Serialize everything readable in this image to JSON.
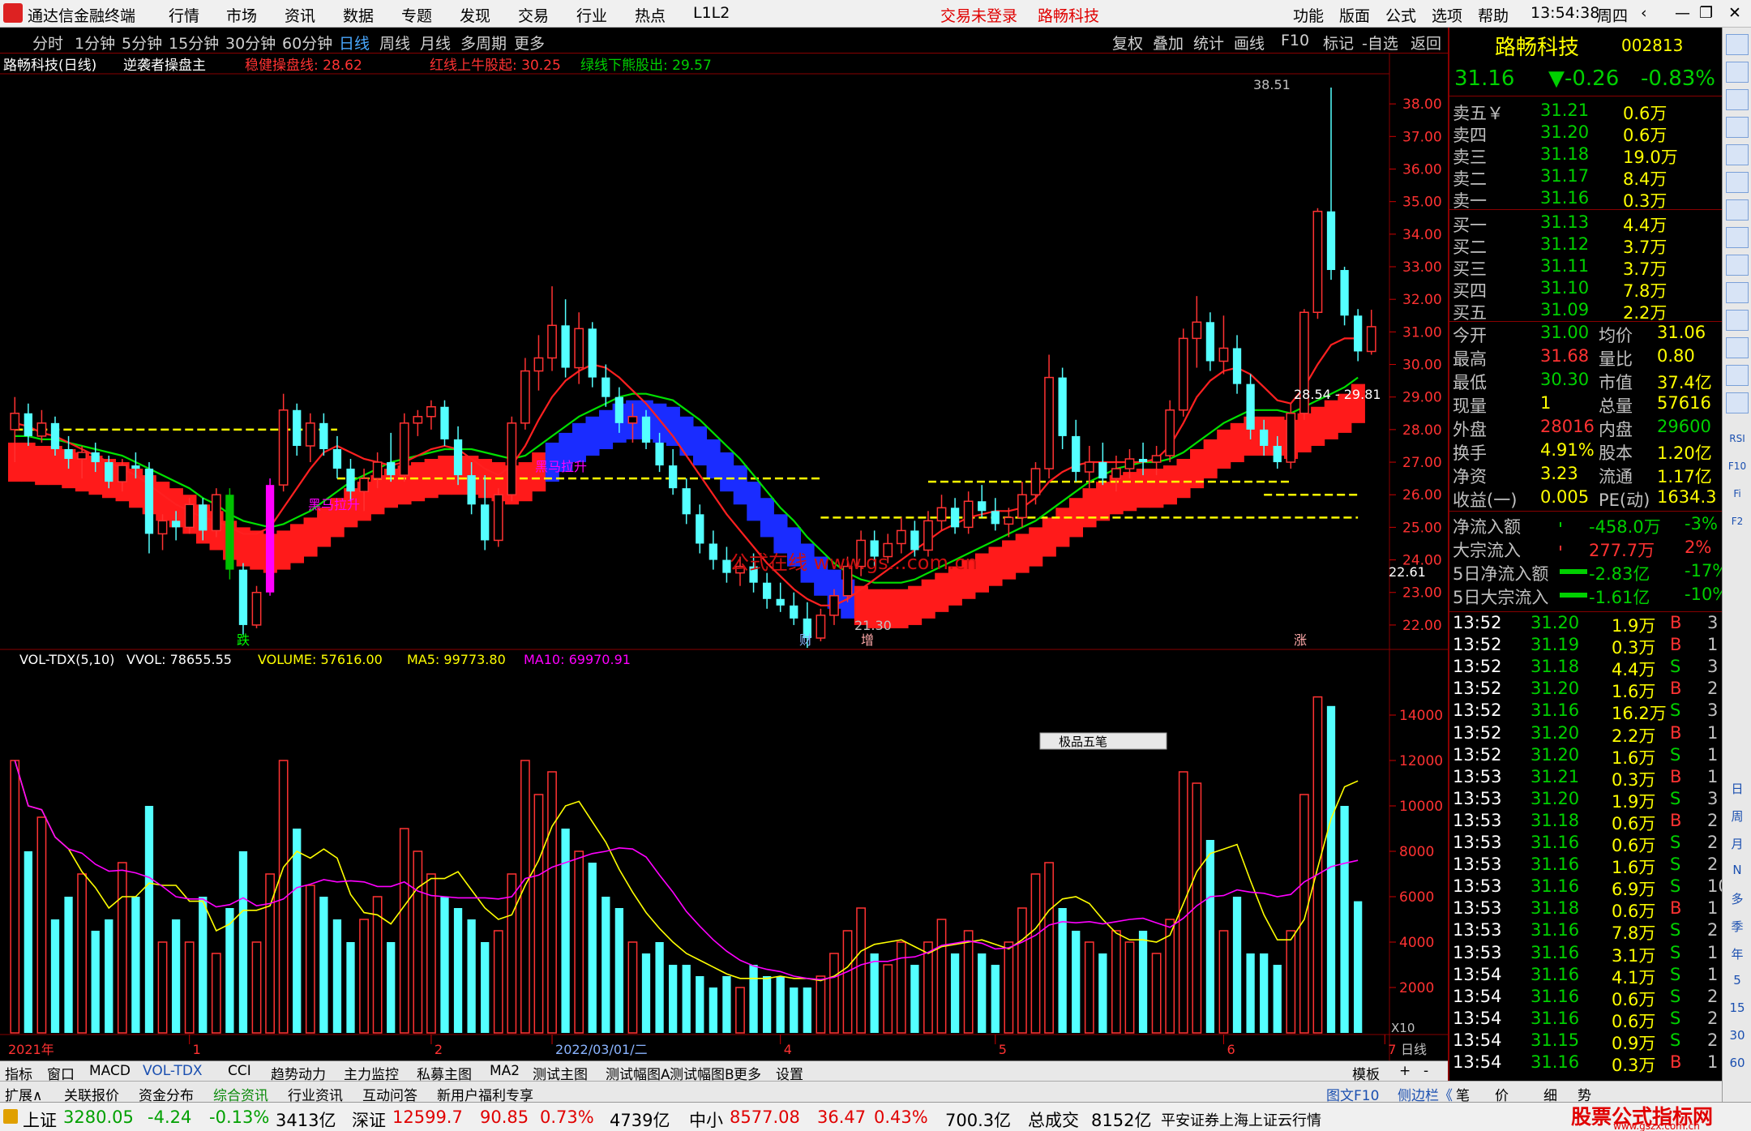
{
  "titlebar": {
    "app": "通达信金融终端",
    "menu": [
      "行情",
      "市场",
      "资讯",
      "数据",
      "专题",
      "发现",
      "交易",
      "行业",
      "热点",
      "L1L2"
    ],
    "login": "交易未登录",
    "stock": "路畅科技",
    "right": [
      "功能",
      "版面",
      "公式",
      "选项",
      "帮助"
    ],
    "time": "13:54:38",
    "weekday": "周四"
  },
  "periods": [
    "分时",
    "1分钟",
    "5分钟",
    "15分钟",
    "30分钟",
    "60分钟",
    "日线",
    "周线",
    "月线",
    "多周期",
    "更多"
  ],
  "period_active": "日线",
  "tools": [
    "复权",
    "叠加",
    "统计",
    "画线",
    "F10",
    "标记",
    "-自选",
    "返回"
  ],
  "main_header": {
    "name": "路畅科技(日线)",
    "indicator": "逆袭者操盘主",
    "l1": "稳健操盘线: 28.62",
    "l2": "红线上牛股起: 30.25",
    "l3": "绿线下熊股出: 29.57"
  },
  "vol_header": {
    "name": "VOL-TDX(5,10)",
    "vvol": "VVOL: 78655.55",
    "volume": "VOLUME: 57616.00",
    "ma5": "MA5: 99773.80",
    "ma10": "MA10: 69970.91"
  },
  "annotations": {
    "high": "38.51",
    "low": "21.30",
    "range": "28.54 - 29.81",
    "current": "22.61",
    "heima1": "黑马拉升",
    "heima2": "黑马拉升",
    "watermark": "公式在线 www.gs...com.cn",
    "die": "跌",
    "cai": "财",
    "zeng": "增",
    "zhang": "涨",
    "mini_panel": "极品五笔"
  },
  "price_axis": [
    "38.00",
    "37.00",
    "36.00",
    "35.00",
    "34.00",
    "33.00",
    "32.00",
    "31.00",
    "30.00",
    "29.00",
    "28.00",
    "27.00",
    "26.00",
    "25.00",
    "24.00",
    "23.00",
    "22.00"
  ],
  "vol_axis": [
    "14000",
    "12000",
    "10000",
    "8000",
    "6000",
    "4000",
    "2000"
  ],
  "vol_unit": "X10",
  "date_axis": [
    "2021年",
    "1",
    "2",
    "2022/03/01/二",
    "4",
    "5",
    "6",
    "7"
  ],
  "date_axis_right": "日线",
  "quote": {
    "name": "路畅科技",
    "code": "002813",
    "price": "31.16",
    "change": "▼-0.26",
    "pct": "-0.83%",
    "asks": [
      {
        "label": "卖五￥",
        "price": "31.21",
        "vol": "0.6万"
      },
      {
        "label": "卖四",
        "price": "31.20",
        "vol": "0.6万"
      },
      {
        "label": "卖三",
        "price": "31.18",
        "vol": "19.0万"
      },
      {
        "label": "卖二",
        "price": "31.17",
        "vol": "8.4万"
      },
      {
        "label": "卖一",
        "price": "31.16",
        "vol": "0.3万"
      }
    ],
    "bids": [
      {
        "label": "买一",
        "price": "31.13",
        "vol": "4.4万"
      },
      {
        "label": "买二",
        "price": "31.12",
        "vol": "3.7万"
      },
      {
        "label": "买三",
        "price": "31.11",
        "vol": "3.7万"
      },
      {
        "label": "买四",
        "price": "31.10",
        "vol": "7.8万"
      },
      {
        "label": "买五",
        "price": "31.09",
        "vol": "2.2万"
      }
    ],
    "stats": [
      [
        "今开",
        "31.00",
        "均价",
        "31.06"
      ],
      [
        "最高",
        "31.68",
        "量比",
        "0.80"
      ],
      [
        "最低",
        "30.30",
        "市值",
        "37.4亿"
      ],
      [
        "现量",
        "1",
        "总量",
        "57616"
      ],
      [
        "外盘",
        "28016",
        "内盘",
        "29600"
      ],
      [
        "换手",
        "4.91%",
        "股本",
        "1.20亿"
      ],
      [
        "净资",
        "3.23",
        "流通",
        "1.17亿"
      ],
      [
        "收益(一)",
        "0.005",
        "PE(动)",
        "1634.3"
      ]
    ],
    "flows": [
      [
        "净流入额",
        "-458.0万",
        "-3%"
      ],
      [
        "大宗流入",
        "277.7万",
        "2%"
      ],
      [
        "5日净流入额",
        "-2.83亿",
        "-17%"
      ],
      [
        "5日大宗流入",
        "-1.61亿",
        "-10%"
      ]
    ],
    "ticks": [
      [
        "13:52",
        "31.20",
        "1.9万",
        "B",
        "3"
      ],
      [
        "13:52",
        "31.19",
        "0.3万",
        "B",
        "1"
      ],
      [
        "13:52",
        "31.18",
        "4.4万",
        "S",
        "3"
      ],
      [
        "13:52",
        "31.20",
        "1.6万",
        "B",
        "2"
      ],
      [
        "13:52",
        "31.16",
        "16.2万",
        "S",
        "3"
      ],
      [
        "13:52",
        "31.20",
        "2.2万",
        "B",
        "1"
      ],
      [
        "13:52",
        "31.20",
        "1.6万",
        "S",
        "1"
      ],
      [
        "13:53",
        "31.21",
        "0.3万",
        "B",
        "1"
      ],
      [
        "13:53",
        "31.20",
        "1.9万",
        "S",
        "3"
      ],
      [
        "13:53",
        "31.18",
        "0.6万",
        "B",
        "2"
      ],
      [
        "13:53",
        "31.16",
        "0.6万",
        "S",
        "2"
      ],
      [
        "13:53",
        "31.16",
        "1.6万",
        "S",
        "2"
      ],
      [
        "13:53",
        "31.16",
        "6.9万",
        "S",
        "10"
      ],
      [
        "13:53",
        "31.18",
        "0.6万",
        "B",
        "1"
      ],
      [
        "13:53",
        "31.16",
        "7.8万",
        "S",
        "2"
      ],
      [
        "13:53",
        "31.16",
        "3.1万",
        "S",
        "1"
      ],
      [
        "13:54",
        "31.16",
        "4.1万",
        "S",
        "1"
      ],
      [
        "13:54",
        "31.16",
        "0.6万",
        "S",
        "2"
      ],
      [
        "13:54",
        "31.16",
        "0.6万",
        "S",
        "2"
      ],
      [
        "13:54",
        "31.15",
        "0.9万",
        "S",
        "2"
      ],
      [
        "13:54",
        "31.16",
        "0.3万",
        "B",
        "1"
      ]
    ]
  },
  "iconbar": [
    "日",
    "周",
    "月",
    "N",
    "多",
    "季",
    "年",
    "5",
    "15",
    "30",
    "60",
    "RSI",
    "F10",
    "Fi",
    "F2"
  ],
  "idxtabs": [
    "指标",
    "窗口",
    "MACD",
    "VOL-TDX",
    "CCI",
    "趋势动力",
    "主力监控",
    "私募主图",
    "MA2",
    "测试主图",
    "测试幅图A",
    "测试幅图B",
    "更多",
    "设置"
  ],
  "idxtabs_right": [
    "模板",
    "+",
    "-"
  ],
  "exttabs": [
    "扩展∧",
    "关联报价",
    "资金分布",
    "综合资讯",
    "行业资讯",
    "互动问答",
    "新用户福利专享"
  ],
  "exttabs_right": [
    "图文F10",
    "侧边栏《",
    "笔",
    "价",
    "细",
    "势"
  ],
  "statusbar": {
    "sh_label": "上证",
    "sh": "3280.05",
    "sh_chg": "-4.24",
    "sh_pct": "-0.13%",
    "sh_amt": "3413亿",
    "sz_label": "深证",
    "sz": "12599.7",
    "sz_chg": "90.85",
    "sz_pct": "0.73%",
    "sz_amt": "4739亿",
    "zx_label": "中小",
    "zx": "8577.08",
    "zx_chg": "36.47",
    "zx_pct": "0.43%",
    "zx_amt": "700.3亿",
    "total_label": "总成交",
    "total": "8152亿",
    "broker": "平安证券上海上证云行情",
    "logo": "股票公式指标网",
    "logo_url": "www.gszx.com.cn"
  },
  "chart_data": {
    "type": "candlestick",
    "ylim": [
      21.5,
      38.8
    ],
    "candles": [
      [
        28,
        29,
        27,
        28.5
      ],
      [
        28.5,
        28.8,
        27.5,
        27.8
      ],
      [
        27.8,
        28.6,
        27.6,
        28.2
      ],
      [
        28.2,
        28.4,
        27.2,
        27.4
      ],
      [
        27.4,
        27.8,
        26.8,
        27.1
      ],
      [
        27.1,
        27.5,
        26.5,
        27.3
      ],
      [
        27.3,
        27.6,
        26.7,
        27
      ],
      [
        27,
        27.2,
        26.2,
        26.4
      ],
      [
        26.4,
        27.1,
        26.1,
        26.9
      ],
      [
        26.9,
        27.3,
        26.5,
        26.8
      ],
      [
        26.8,
        27,
        24.2,
        24.8
      ],
      [
        24.8,
        25.4,
        24.3,
        25.2
      ],
      [
        25.2,
        25.5,
        24.6,
        25
      ],
      [
        25,
        25.9,
        24.8,
        25.7
      ],
      [
        25.7,
        25.9,
        24.6,
        24.9
      ],
      [
        24.9,
        26.2,
        24.7,
        26
      ],
      [
        26,
        26.2,
        23.4,
        23.7
      ],
      [
        23.7,
        23.9,
        21.7,
        22
      ],
      [
        22,
        23.2,
        21.9,
        23
      ],
      [
        23,
        26.5,
        22.9,
        26.3
      ],
      [
        26.3,
        29.1,
        26.1,
        28.6
      ],
      [
        28.6,
        28.8,
        27.2,
        27.5
      ],
      [
        27.5,
        28.5,
        27,
        28.2
      ],
      [
        28.2,
        28.5,
        27.2,
        27.4
      ],
      [
        27.4,
        27.8,
        26.5,
        26.8
      ],
      [
        26.8,
        27.1,
        25.8,
        26.1
      ],
      [
        26.1,
        26.8,
        25.5,
        26.5
      ],
      [
        26.5,
        27.3,
        26.2,
        27
      ],
      [
        27,
        27.9,
        26.4,
        26.6
      ],
      [
        26.6,
        28.5,
        26.4,
        28.2
      ],
      [
        28.2,
        28.6,
        27.8,
        28.4
      ],
      [
        28.4,
        28.9,
        28,
        28.7
      ],
      [
        28.7,
        28.9,
        27.5,
        27.7
      ],
      [
        27.7,
        28.1,
        26.3,
        26.6
      ],
      [
        26.6,
        27,
        25.4,
        25.7
      ],
      [
        25.7,
        26.6,
        24.3,
        24.6
      ],
      [
        24.6,
        26.2,
        24.4,
        26
      ],
      [
        26,
        28.4,
        25.8,
        28.2
      ],
      [
        28.2,
        30.2,
        28,
        29.8
      ],
      [
        29.8,
        30.9,
        29.2,
        30.2
      ],
      [
        30.2,
        32.4,
        29.8,
        31.2
      ],
      [
        31.2,
        32,
        29.6,
        29.9
      ],
      [
        29.9,
        31.6,
        29.4,
        31.1
      ],
      [
        31.1,
        31.3,
        29.3,
        29.6
      ],
      [
        29.6,
        30,
        28.7,
        29
      ],
      [
        29,
        29.3,
        27.9,
        28.2
      ],
      [
        28.2,
        28.8,
        27.6,
        28.4
      ],
      [
        28.4,
        28.6,
        27.4,
        27.6
      ],
      [
        27.6,
        27.9,
        26.7,
        26.9
      ],
      [
        26.9,
        27.4,
        26,
        26.2
      ],
      [
        26.2,
        26.5,
        25.1,
        25.4
      ],
      [
        25.4,
        25.7,
        24.2,
        24.5
      ],
      [
        24.5,
        24.9,
        23.7,
        24
      ],
      [
        24,
        24.4,
        23.3,
        23.6
      ],
      [
        23.6,
        24.1,
        23.2,
        23.8
      ],
      [
        23.8,
        24.2,
        23,
        23.3
      ],
      [
        23.3,
        23.6,
        22.5,
        22.8
      ],
      [
        22.8,
        23.3,
        22.4,
        22.6
      ],
      [
        22.6,
        23,
        22,
        22.2
      ],
      [
        22.2,
        22.7,
        21.3,
        21.6
      ],
      [
        21.6,
        22.5,
        21.5,
        22.3
      ],
      [
        22.3,
        23.1,
        22,
        22.9
      ],
      [
        22.9,
        24.1,
        22.7,
        23.8
      ],
      [
        23.8,
        24.9,
        23.5,
        24.6
      ],
      [
        24.6,
        24.9,
        23.8,
        24.1
      ],
      [
        24.1,
        24.8,
        23.9,
        24.5
      ],
      [
        24.5,
        25.3,
        24.2,
        24.9
      ],
      [
        24.9,
        25.2,
        24.1,
        24.3
      ],
      [
        24.3,
        25.5,
        24.1,
        25.2
      ],
      [
        25.2,
        26,
        24.9,
        25.6
      ],
      [
        25.6,
        25.9,
        24.8,
        25
      ],
      [
        25,
        26.1,
        24.8,
        25.8
      ],
      [
        25.8,
        26.3,
        25.3,
        25.5
      ],
      [
        25.5,
        25.9,
        24.9,
        25.1
      ],
      [
        25.1,
        25.6,
        24.7,
        25.3
      ],
      [
        25.3,
        26.4,
        25,
        26
      ],
      [
        26,
        27,
        25.7,
        26.8
      ],
      [
        26.8,
        30.3,
        26.5,
        29.6
      ],
      [
        29.6,
        29.9,
        27.4,
        27.8
      ],
      [
        27.8,
        28.3,
        26.4,
        26.7
      ],
      [
        26.7,
        27.5,
        26.2,
        27
      ],
      [
        27,
        27.6,
        26.3,
        26.5
      ],
      [
        26.5,
        27.2,
        26.1,
        26.8
      ],
      [
        26.8,
        27.4,
        26.5,
        27.1
      ],
      [
        27.1,
        27.6,
        26.6,
        27
      ],
      [
        27,
        27.5,
        26.6,
        27.2
      ],
      [
        27.2,
        28.9,
        27,
        28.6
      ],
      [
        28.6,
        31.1,
        28.4,
        30.8
      ],
      [
        30.8,
        32.1,
        29.9,
        31.3
      ],
      [
        31.3,
        31.6,
        29.8,
        30.1
      ],
      [
        30.1,
        31.5,
        29.7,
        30.5
      ],
      [
        30.5,
        30.9,
        29.1,
        29.4
      ],
      [
        29.4,
        29.7,
        27.7,
        28
      ],
      [
        28,
        28.3,
        27.2,
        27.5
      ],
      [
        27.5,
        27.8,
        26.8,
        27
      ],
      [
        27,
        28.8,
        26.8,
        28.5
      ],
      [
        28.5,
        31.7,
        28.3,
        31.6
      ],
      [
        31.6,
        34.8,
        31.4,
        34.7
      ],
      [
        34.7,
        38.5,
        32.6,
        32.9
      ],
      [
        32.9,
        33,
        31.2,
        31.5
      ],
      [
        31.5,
        31.7,
        30.1,
        30.4
      ],
      [
        30.4,
        31.68,
        30.3,
        31.16
      ]
    ],
    "volumes": [
      12000,
      8000,
      9500,
      5000,
      6000,
      7000,
      4500,
      5000,
      7500,
      6000,
      10000,
      4000,
      5000,
      4000,
      6000,
      3500,
      5500,
      8000,
      4000,
      7000,
      12000,
      9000,
      6500,
      6000,
      5000,
      4000,
      5000,
      6000,
      4000,
      9000,
      8000,
      7000,
      6000,
      5500,
      5000,
      4000,
      4500,
      7000,
      12000,
      10500,
      11500,
      9000,
      8000,
      7500,
      6000,
      5500,
      4000,
      3500,
      4000,
      3000,
      3000,
      2500,
      2000,
      2500,
      2000,
      3000,
      2500,
      2500,
      2000,
      2000,
      2500,
      3500,
      4500,
      5500,
      3500,
      3000,
      4000,
      3000,
      4000,
      5000,
      3500,
      4500,
      3500,
      3000,
      4000,
      5500,
      7000,
      7500,
      5500,
      4500,
      4000,
      3500,
      4500,
      4000,
      4500,
      3500,
      5000,
      11500,
      11000,
      8500,
      4500,
      6000,
      3500,
      3500,
      3000,
      4500,
      10500,
      14800,
      14400,
      10000,
      5800
    ],
    "ma_red": [
      28.2,
      28.1,
      27.9,
      27.8,
      27.6,
      27.4,
      27.2,
      27,
      26.8,
      26.6,
      26.3,
      26,
      25.7,
      25.5,
      25.3,
      25.2,
      25,
      24.8,
      24.8,
      25,
      25.6,
      26.2,
      26.8,
      27.3,
      27.5,
      27.3,
      27.1,
      27,
      26.9,
      27,
      27.2,
      27.4,
      27.5,
      27.4,
      27.1,
      26.8,
      26.6,
      26.9,
      27.5,
      28.3,
      29,
      29.5,
      29.8,
      30,
      29.9,
      29.6,
      29.2,
      28.8,
      28.3,
      27.8,
      27.2,
      26.6,
      26,
      25.4,
      24.9,
      24.4,
      23.9,
      23.5,
      23.1,
      22.8,
      22.6,
      22.6,
      22.8,
      23.1,
      23.4,
      23.7,
      24,
      24.3,
      24.6,
      24.9,
      25.1,
      25.3,
      25.4,
      25.5,
      25.5,
      25.6,
      25.9,
      26.4,
      26.7,
      26.9,
      27,
      27,
      27,
      27,
      27,
      27.1,
      27.5,
      28.2,
      29,
      29.5,
      29.8,
      29.9,
      29.7,
      29.3,
      28.9,
      28.8,
      29.3,
      30,
      30.6,
      30.8,
      30.8
    ],
    "ma_green": [
      27.8,
      27.8,
      27.7,
      27.7,
      27.6,
      27.5,
      27.4,
      27.3,
      27.2,
      27,
      26.8,
      26.6,
      26.4,
      26.2,
      25.9,
      25.7,
      25.4,
      25.2,
      25.1,
      25,
      25.1,
      25.3,
      25.5,
      25.8,
      26.1,
      26.4,
      26.6,
      26.8,
      27,
      27.1,
      27.2,
      27.3,
      27.4,
      27.4,
      27.4,
      27.3,
      27.2,
      27.1,
      27.2,
      27.5,
      27.8,
      28.1,
      28.4,
      28.6,
      28.8,
      29,
      29.1,
      29.1,
      29,
      28.9,
      28.6,
      28.3,
      27.9,
      27.5,
      27.1,
      26.6,
      26.1,
      25.6,
      25.2,
      24.7,
      24.3,
      23.9,
      23.6,
      23.4,
      23.3,
      23.3,
      23.3,
      23.4,
      23.6,
      23.8,
      24,
      24.2,
      24.4,
      24.6,
      24.8,
      25,
      25.2,
      25.5,
      25.8,
      26.1,
      26.4,
      26.6,
      26.8,
      26.9,
      27,
      27,
      27.1,
      27.3,
      27.6,
      27.9,
      28.2,
      28.4,
      28.6,
      28.6,
      28.6,
      28.5,
      28.7,
      28.9,
      29.1,
      29.3,
      29.6
    ]
  }
}
